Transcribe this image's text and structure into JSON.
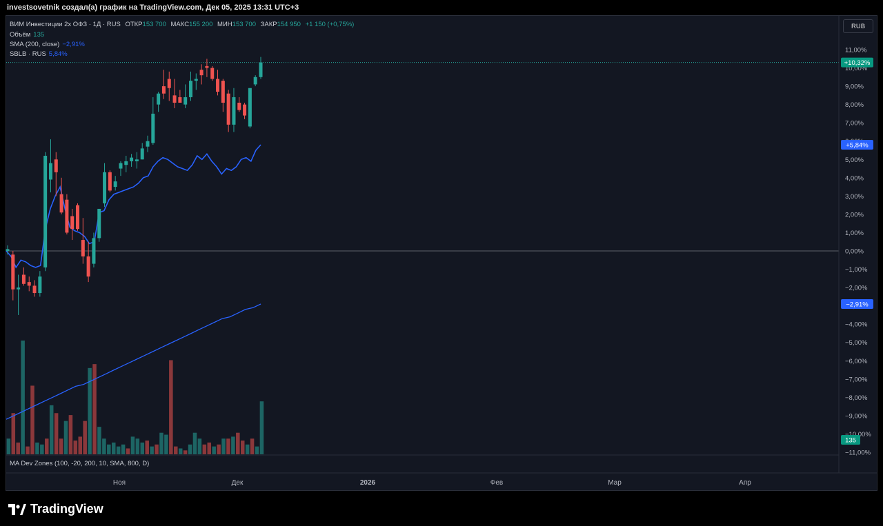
{
  "header": "investsovetnik создал(а) график на TradingView.com, Дек 05, 2025 13:31 UTC+3",
  "legend": {
    "symbol": "ВИМ Инвестиции 2x ОФЗ · 1Д · RUS",
    "open_label": "ОТКР",
    "open": "153 700",
    "high_label": "МАКС",
    "high": "155 200",
    "low_label": "МИН",
    "low": "153 700",
    "close_label": "ЗАКР",
    "close": "154 950",
    "change": "+1 150 (+0,75%)",
    "volume_label": "Объём",
    "volume": "135",
    "sma_label": "SMA (200, close)",
    "sma_value": "−2,91%",
    "compare_label": "SBLB · RUS",
    "compare_value": "5,84%"
  },
  "currency_button": "RUB",
  "indicator_label": "MA Dev Zones (100, -20, 200, 10, SMA, 800, D)",
  "brand": "TradingView",
  "colors": {
    "up": "#26a69a",
    "down": "#ef5350",
    "compare": "#2962ff",
    "sma": "#2962ff",
    "background": "#131722"
  },
  "chart_data": {
    "type": "candlestick",
    "ylabel": "%",
    "ylim": [
      -11,
      11
    ],
    "y_ticks": [
      "11,00%",
      "10,00%",
      "9,00%",
      "8,00%",
      "7,00%",
      "6,00%",
      "5,00%",
      "4,00%",
      "3,00%",
      "2,00%",
      "1,00%",
      "0,00%",
      "−1,00%",
      "−2,00%",
      "−3,00%",
      "−4,00%",
      "−5,00%",
      "−6,00%",
      "−7,00%",
      "−8,00%",
      "−9,00%",
      "−10,00%",
      "−11,00%"
    ],
    "x_ticks": [
      "Ноя",
      "Дек",
      "2026",
      "Фев",
      "Мар",
      "Апр"
    ],
    "price_labels": {
      "last": "+10,32%",
      "compare": "+5,84%",
      "sma": "−2,91%",
      "volume": "135"
    },
    "candles": [
      {
        "o": 0.0,
        "h": 0.3,
        "l": -0.2,
        "c": 0.1
      },
      {
        "o": -0.2,
        "h": 0.0,
        "l": -2.7,
        "c": -2.1
      },
      {
        "o": -2.1,
        "h": -1.3,
        "l": -3.5,
        "c": -2.0
      },
      {
        "o": -1.3,
        "h": -0.9,
        "l": -1.9,
        "c": -1.8
      },
      {
        "o": -1.7,
        "h": -1.4,
        "l": -2.2,
        "c": -1.9
      },
      {
        "o": -1.9,
        "h": -1.6,
        "l": -2.5,
        "c": -2.3
      },
      {
        "o": -2.3,
        "h": -1.1,
        "l": -2.5,
        "c": -1.4
      },
      {
        "o": -0.9,
        "h": 5.4,
        "l": -1.1,
        "c": 5.2
      },
      {
        "o": 3.9,
        "h": 6.1,
        "l": 3.2,
        "c": 4.8
      },
      {
        "o": 5.0,
        "h": 5.4,
        "l": 3.0,
        "c": 4.3
      },
      {
        "o": 3.1,
        "h": 4.0,
        "l": 2.0,
        "c": 2.1
      },
      {
        "o": 2.8,
        "h": 3.1,
        "l": 0.9,
        "c": 1.0
      },
      {
        "o": 1.9,
        "h": 2.3,
        "l": 0.6,
        "c": 1.2
      },
      {
        "o": 2.5,
        "h": 2.6,
        "l": 1.1,
        "c": 1.2
      },
      {
        "o": 0.6,
        "h": 1.8,
        "l": -0.7,
        "c": -0.3
      },
      {
        "o": -0.3,
        "h": 0.5,
        "l": -1.7,
        "c": -1.4
      },
      {
        "o": -0.7,
        "h": 1.0,
        "l": -0.9,
        "c": 0.7
      },
      {
        "o": 0.7,
        "h": 2.3,
        "l": 0.5,
        "c": 2.3
      },
      {
        "o": 2.6,
        "h": 4.8,
        "l": 2.4,
        "c": 4.3
      },
      {
        "o": 4.3,
        "h": 4.4,
        "l": 3.2,
        "c": 3.3
      },
      {
        "o": 3.5,
        "h": 4.1,
        "l": 3.3,
        "c": 3.8
      },
      {
        "o": 4.5,
        "h": 4.9,
        "l": 4.1,
        "c": 4.8
      },
      {
        "o": 4.7,
        "h": 5.2,
        "l": 4.3,
        "c": 4.9
      },
      {
        "o": 4.9,
        "h": 5.3,
        "l": 4.6,
        "c": 5.1
      },
      {
        "o": 4.9,
        "h": 5.4,
        "l": 4.5,
        "c": 5.0
      },
      {
        "o": 5.0,
        "h": 5.9,
        "l": 5.0,
        "c": 5.6
      },
      {
        "o": 5.7,
        "h": 6.3,
        "l": 5.4,
        "c": 6.0
      },
      {
        "o": 5.9,
        "h": 8.4,
        "l": 5.8,
        "c": 7.5
      },
      {
        "o": 8.0,
        "h": 8.7,
        "l": 7.6,
        "c": 8.6
      },
      {
        "o": 9.0,
        "h": 9.9,
        "l": 8.3,
        "c": 8.6
      },
      {
        "o": 9.4,
        "h": 9.8,
        "l": 8.2,
        "c": 8.9
      },
      {
        "o": 8.5,
        "h": 9.4,
        "l": 7.8,
        "c": 8.1
      },
      {
        "o": 8.4,
        "h": 8.8,
        "l": 8.1,
        "c": 8.1
      },
      {
        "o": 8.0,
        "h": 9.1,
        "l": 7.8,
        "c": 8.4
      },
      {
        "o": 8.4,
        "h": 9.8,
        "l": 8.2,
        "c": 9.3
      },
      {
        "o": 9.3,
        "h": 9.7,
        "l": 8.8,
        "c": 9.4
      },
      {
        "o": 9.9,
        "h": 10.2,
        "l": 9.1,
        "c": 9.6
      },
      {
        "o": 10.1,
        "h": 10.5,
        "l": 9.5,
        "c": 10.0
      },
      {
        "o": 10.0,
        "h": 10.1,
        "l": 9.3,
        "c": 9.4
      },
      {
        "o": 9.4,
        "h": 9.9,
        "l": 8.5,
        "c": 8.7
      },
      {
        "o": 9.3,
        "h": 9.4,
        "l": 7.6,
        "c": 8.1
      },
      {
        "o": 8.6,
        "h": 8.8,
        "l": 6.5,
        "c": 6.9
      },
      {
        "o": 6.9,
        "h": 8.9,
        "l": 6.5,
        "c": 8.4
      },
      {
        "o": 8.1,
        "h": 8.4,
        "l": 7.6,
        "c": 7.7
      },
      {
        "o": 8.0,
        "h": 8.1,
        "l": 7.2,
        "c": 7.4
      },
      {
        "o": 6.8,
        "h": 8.9,
        "l": 6.7,
        "c": 8.9
      },
      {
        "o": 9.1,
        "h": 9.6,
        "l": 9.0,
        "c": 9.5
      },
      {
        "o": 9.5,
        "h": 10.6,
        "l": 9.4,
        "c": 10.3
      }
    ],
    "compare_series": {
      "name": "SBLB · RUS",
      "values": [
        0.0,
        -0.3,
        -0.9,
        -0.5,
        -0.6,
        -0.8,
        -0.9,
        -0.8,
        1.2,
        2.3,
        3.0,
        3.5,
        2.3,
        1.3,
        1.1,
        1.0,
        0.8,
        0.4,
        0.5,
        2.1,
        2.2,
        2.8,
        3.1,
        3.2,
        3.3,
        3.4,
        3.5,
        3.7,
        4.0,
        4.1,
        4.6,
        4.9,
        5.1,
        5.0,
        4.8,
        4.6,
        4.5,
        4.4,
        4.7,
        5.2,
        5.0,
        5.3,
        4.9,
        4.6,
        4.2,
        4.5,
        4.4,
        4.6,
        5.0,
        5.1,
        4.9,
        5.5,
        5.8
      ]
    },
    "sma_series": {
      "name": "SMA (200, close)",
      "values": [
        -9.2,
        -9.0,
        -8.8,
        -8.6,
        -8.4,
        -8.2,
        -8.0,
        -7.8,
        -7.6,
        -7.4,
        -7.3,
        -7.1,
        -6.9,
        -6.7,
        -6.5,
        -6.3,
        -6.1,
        -5.9,
        -5.7,
        -5.5,
        -5.3,
        -5.1,
        -4.9,
        -4.7,
        -4.5,
        -4.3,
        -4.1,
        -3.9,
        -3.7,
        -3.6,
        -3.4,
        -3.2,
        -3.1,
        -2.9
      ]
    },
    "volume": {
      "values": [
        40,
        105,
        30,
        290,
        20,
        175,
        30,
        25,
        40,
        125,
        105,
        40,
        85,
        100,
        35,
        45,
        85,
        220,
        230,
        70,
        40,
        25,
        30,
        20,
        25,
        15,
        45,
        40,
        30,
        35,
        20,
        25,
        55,
        50,
        240,
        20,
        15,
        10,
        25,
        55,
        40,
        25,
        30,
        20,
        25,
        40,
        40,
        45,
        55,
        35,
        25,
        40,
        20,
        135
      ],
      "up": [
        true,
        false,
        false,
        true,
        false,
        false,
        true,
        true,
        false,
        true,
        false,
        false,
        true,
        false,
        false,
        false,
        false,
        true,
        false,
        true,
        true,
        true,
        true,
        true,
        true,
        false,
        true,
        true,
        true,
        false,
        true,
        false,
        true,
        true,
        false,
        false,
        true,
        false,
        true,
        true,
        true,
        false,
        false,
        true,
        false,
        true,
        false,
        true,
        false,
        false,
        true,
        false,
        true,
        true
      ]
    }
  }
}
